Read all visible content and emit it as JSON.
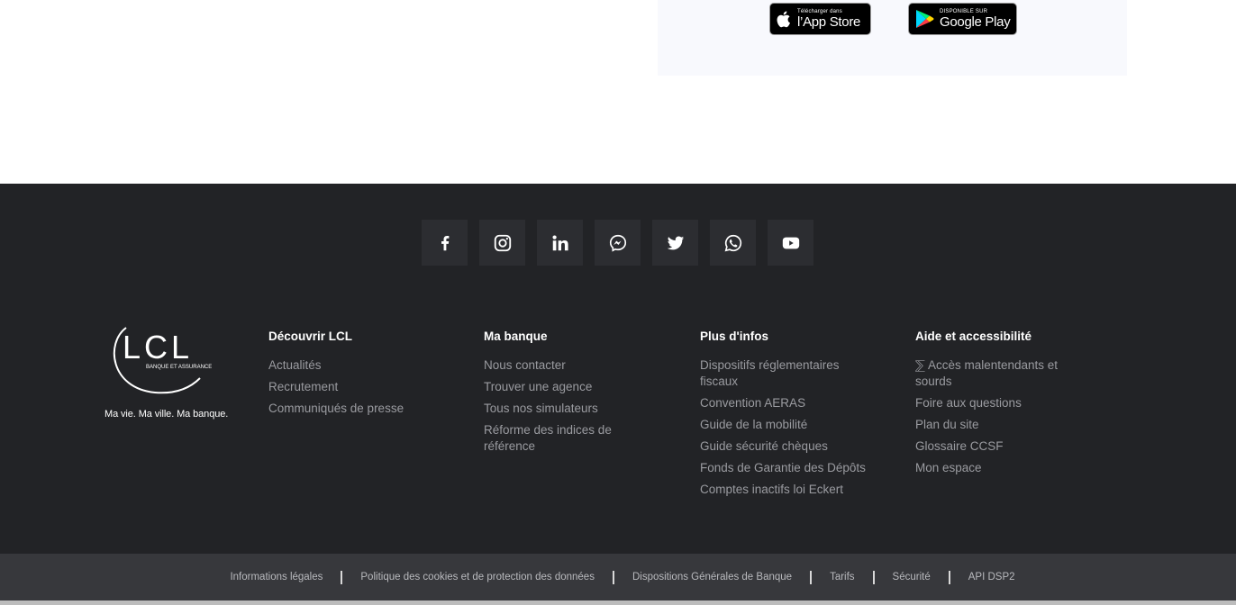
{
  "app_store": {
    "apple_small": "Télécharger dans",
    "apple_big": "l’App Store",
    "google_small": "DISPONIBLE SUR",
    "google_big": "Google Play"
  },
  "social": [
    {
      "name": "facebook-icon"
    },
    {
      "name": "instagram-icon"
    },
    {
      "name": "linkedin-icon"
    },
    {
      "name": "messenger-icon"
    },
    {
      "name": "twitter-icon"
    },
    {
      "name": "whatsapp-icon"
    },
    {
      "name": "youtube-icon"
    }
  ],
  "brand": {
    "logo_text": "LCL",
    "logo_sub": "BANQUE ET ASSURANCE",
    "tagline": "Ma vie. Ma ville. Ma banque."
  },
  "columns": [
    {
      "title": "Découvrir LCL",
      "links": [
        "Actualités",
        "Recrutement",
        "Communiqués de presse"
      ]
    },
    {
      "title": "Ma banque",
      "links": [
        "Nous contacter",
        "Trouver une agence",
        "Tous nos simulateurs",
        "Réforme des indices de référence"
      ]
    },
    {
      "title": "Plus d'infos",
      "links": [
        "Dispositifs réglementaires fiscaux",
        "Convention AERAS",
        "Guide de la mobilité",
        "Guide sécurité chèques",
        "Fonds de Garantie des Dépôts",
        "Comptes inactifs loi Eckert"
      ]
    },
    {
      "title": "Aide et accessibilité",
      "links": [
        "Accès malentendants et sourds",
        "Foire aux questions",
        "Plan du site",
        "Glossaire CCSF",
        "Mon espace"
      ]
    }
  ],
  "legal_links": [
    "Informations légales",
    "Politique des cookies et de protection des données",
    "Dispositions Générales de Banque",
    "Tarifs",
    "Sécurité",
    "API DSP2"
  ]
}
